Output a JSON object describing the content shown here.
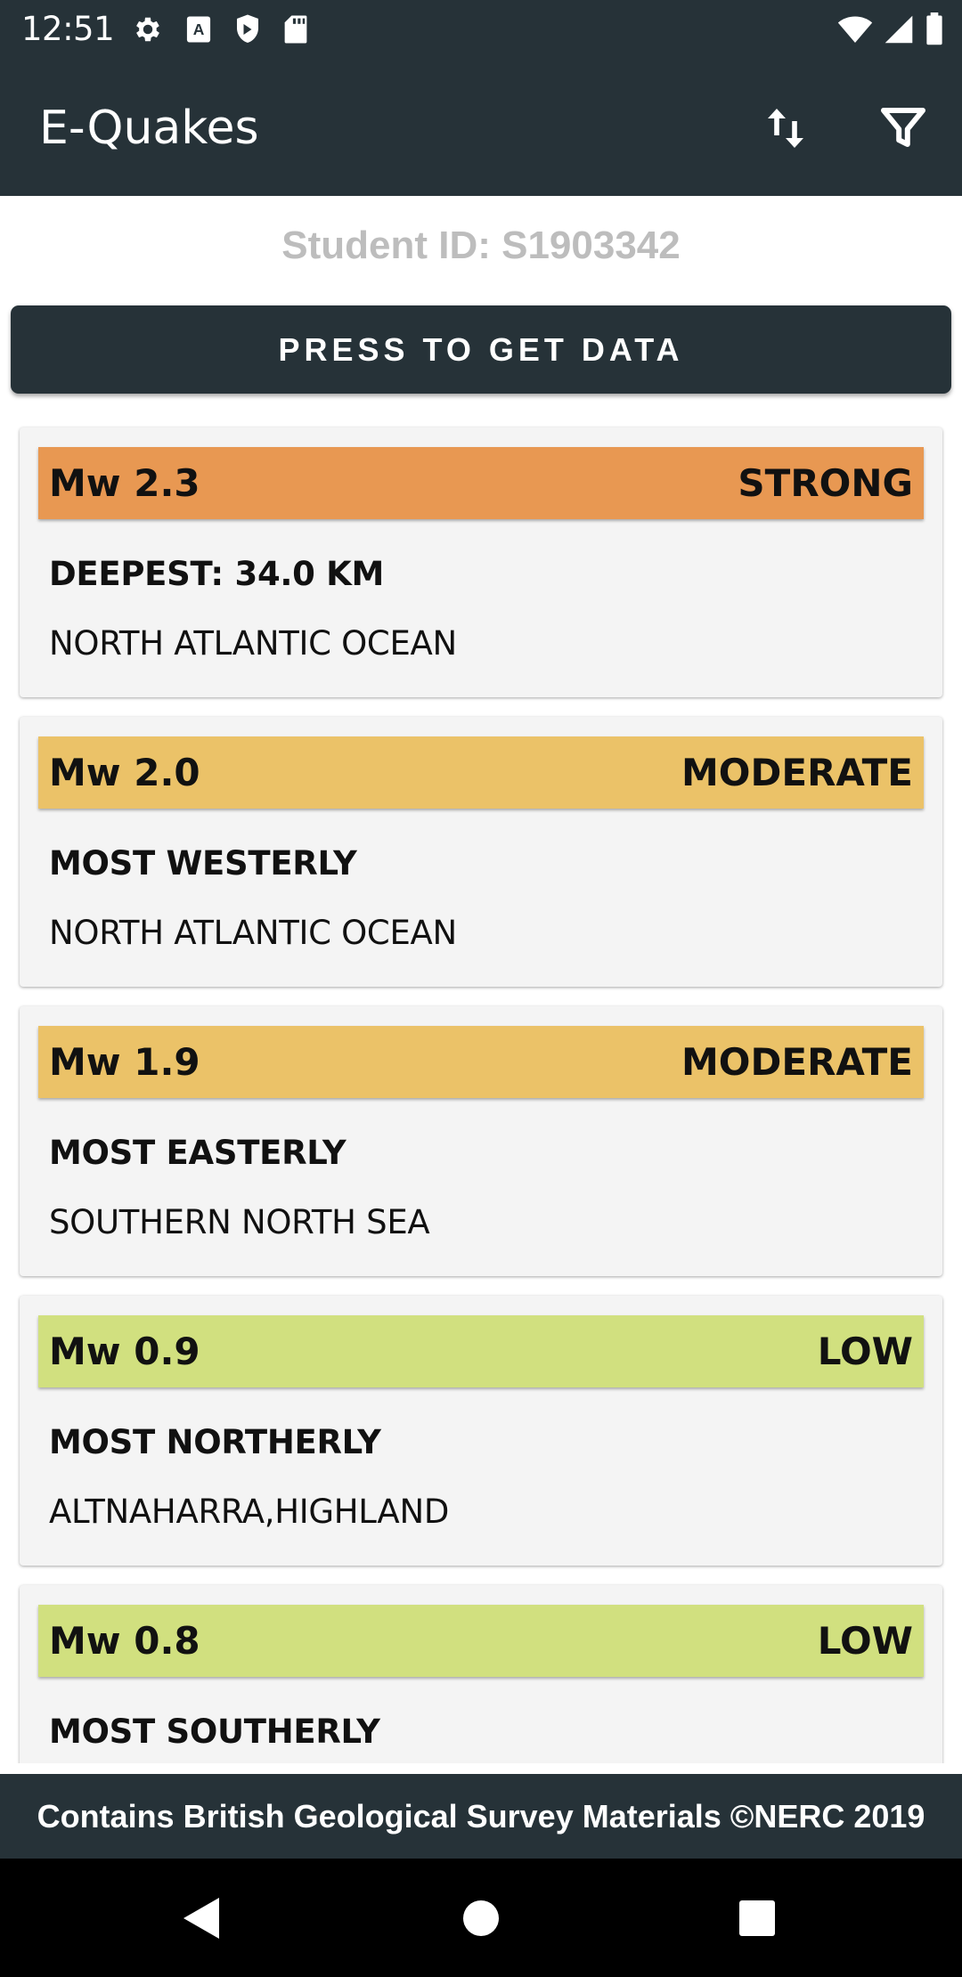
{
  "status_bar": {
    "time": "12:51",
    "left_icons": [
      "settings-icon",
      "font-icon",
      "shield-icon",
      "sd-card-icon"
    ],
    "right_icons": [
      "wifi-icon",
      "cell-signal-icon",
      "battery-icon"
    ]
  },
  "app_bar": {
    "title": "E-Quakes",
    "actions": [
      "sort-icon",
      "filter-icon"
    ]
  },
  "student_id": "Student ID: S1903342",
  "get_data_button": "PRESS TO GET DATA",
  "colors": {
    "primary": "#263238",
    "strong": "#E89852",
    "moderate": "#EBC268",
    "low": "#D1E07F"
  },
  "quakes": [
    {
      "magnitude": "Mw 2.3",
      "severity": "STRONG",
      "severity_color": "#E89852",
      "title": "DEEPEST: 34.0 KM",
      "location": "NORTH ATLANTIC OCEAN"
    },
    {
      "magnitude": "Mw 2.0",
      "severity": "MODERATE",
      "severity_color": "#EBC268",
      "title": "MOST WESTERLY",
      "location": "NORTH ATLANTIC OCEAN"
    },
    {
      "magnitude": "Mw 1.9",
      "severity": "MODERATE",
      "severity_color": "#EBC268",
      "title": "MOST EASTERLY",
      "location": "SOUTHERN NORTH SEA"
    },
    {
      "magnitude": "Mw 0.9",
      "severity": "LOW",
      "severity_color": "#D1E07F",
      "title": "MOST NORTHERLY",
      "location": "ALTNAHARRA,HIGHLAND"
    },
    {
      "magnitude": "Mw 0.8",
      "severity": "LOW",
      "severity_color": "#D1E07F",
      "title": "MOST SOUTHERLY",
      "location": ""
    }
  ],
  "footer": "Contains British Geological Survey Materials ©NERC 2019",
  "nav_bar": [
    "back-icon",
    "home-icon",
    "recents-icon"
  ]
}
